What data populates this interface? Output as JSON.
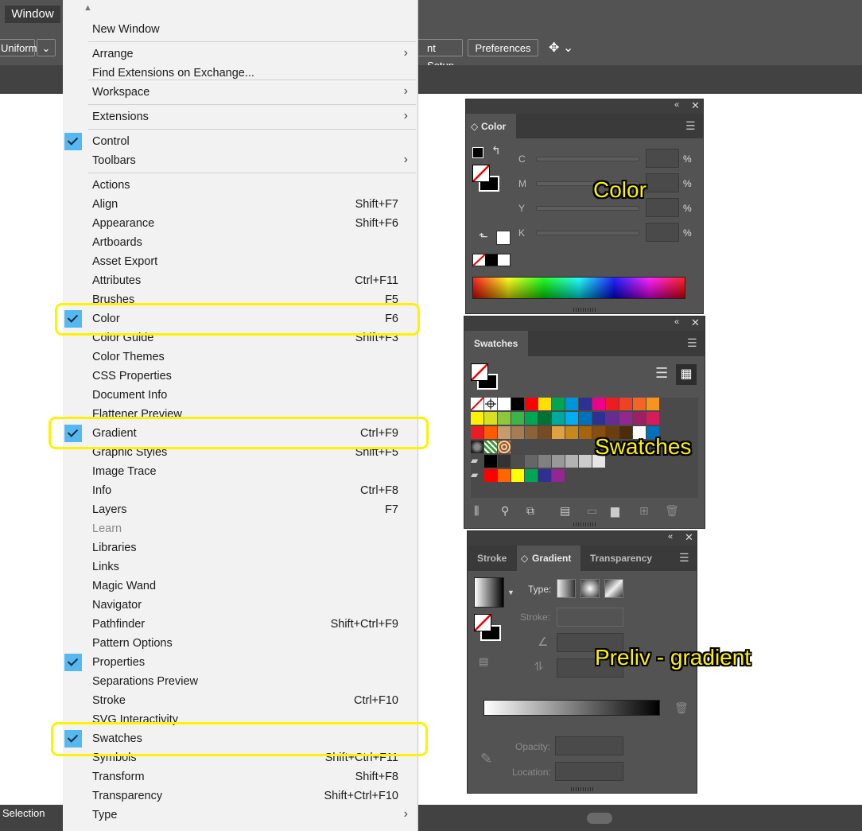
{
  "menubar": {
    "window_label": "Window"
  },
  "controlbar": {
    "uniform_label": "Uniform",
    "document_setup_fragment": "nt Setup",
    "preferences_label": "Preferences"
  },
  "statusbar": {
    "selection_label": "Selection"
  },
  "menu": {
    "items": [
      {
        "label": "New Window",
        "shortcut": "",
        "submenu": false,
        "checked": false
      },
      {
        "label": "Arrange",
        "shortcut": "",
        "submenu": true,
        "checked": false
      },
      {
        "label": "Find Extensions on Exchange...",
        "shortcut": "",
        "submenu": false,
        "checked": false
      },
      {
        "label": "Workspace",
        "shortcut": "",
        "submenu": true,
        "checked": false
      },
      {
        "label": "Extensions",
        "shortcut": "",
        "submenu": true,
        "checked": false
      },
      {
        "label": "Control",
        "shortcut": "",
        "submenu": false,
        "checked": true
      },
      {
        "label": "Toolbars",
        "shortcut": "",
        "submenu": true,
        "checked": false
      },
      {
        "label": "Actions",
        "shortcut": "",
        "submenu": false,
        "checked": false
      },
      {
        "label": "Align",
        "shortcut": "Shift+F7",
        "submenu": false,
        "checked": false
      },
      {
        "label": "Appearance",
        "shortcut": "Shift+F6",
        "submenu": false,
        "checked": false
      },
      {
        "label": "Artboards",
        "shortcut": "",
        "submenu": false,
        "checked": false
      },
      {
        "label": "Asset Export",
        "shortcut": "",
        "submenu": false,
        "checked": false
      },
      {
        "label": "Attributes",
        "shortcut": "Ctrl+F11",
        "submenu": false,
        "checked": false
      },
      {
        "label": "Brushes",
        "shortcut": "F5",
        "submenu": false,
        "checked": false
      },
      {
        "label": "Color",
        "shortcut": "F6",
        "submenu": false,
        "checked": true
      },
      {
        "label": "Color Guide",
        "shortcut": "Shift+F3",
        "submenu": false,
        "checked": false
      },
      {
        "label": "Color Themes",
        "shortcut": "",
        "submenu": false,
        "checked": false
      },
      {
        "label": "CSS Properties",
        "shortcut": "",
        "submenu": false,
        "checked": false
      },
      {
        "label": "Document Info",
        "shortcut": "",
        "submenu": false,
        "checked": false
      },
      {
        "label": "Flattener Preview",
        "shortcut": "",
        "submenu": false,
        "checked": false
      },
      {
        "label": "Gradient",
        "shortcut": "Ctrl+F9",
        "submenu": false,
        "checked": true
      },
      {
        "label": "Graphic Styles",
        "shortcut": "Shift+F5",
        "submenu": false,
        "checked": false
      },
      {
        "label": "Image Trace",
        "shortcut": "",
        "submenu": false,
        "checked": false
      },
      {
        "label": "Info",
        "shortcut": "Ctrl+F8",
        "submenu": false,
        "checked": false
      },
      {
        "label": "Layers",
        "shortcut": "F7",
        "submenu": false,
        "checked": false
      },
      {
        "label": "Learn",
        "shortcut": "",
        "submenu": false,
        "checked": false,
        "disabled": true
      },
      {
        "label": "Libraries",
        "shortcut": "",
        "submenu": false,
        "checked": false
      },
      {
        "label": "Links",
        "shortcut": "",
        "submenu": false,
        "checked": false
      },
      {
        "label": "Magic Wand",
        "shortcut": "",
        "submenu": false,
        "checked": false
      },
      {
        "label": "Navigator",
        "shortcut": "",
        "submenu": false,
        "checked": false
      },
      {
        "label": "Pathfinder",
        "shortcut": "Shift+Ctrl+F9",
        "submenu": false,
        "checked": false
      },
      {
        "label": "Pattern Options",
        "shortcut": "",
        "submenu": false,
        "checked": false
      },
      {
        "label": "Properties",
        "shortcut": "",
        "submenu": false,
        "checked": true
      },
      {
        "label": "Separations Preview",
        "shortcut": "",
        "submenu": false,
        "checked": false
      },
      {
        "label": "Stroke",
        "shortcut": "Ctrl+F10",
        "submenu": false,
        "checked": false
      },
      {
        "label": "SVG Interactivity",
        "shortcut": "",
        "submenu": false,
        "checked": false
      },
      {
        "label": "Swatches",
        "shortcut": "",
        "submenu": false,
        "checked": true
      },
      {
        "label": "Symbols",
        "shortcut": "Shift+Ctrl+F11",
        "submenu": false,
        "checked": false
      },
      {
        "label": "Transform",
        "shortcut": "Shift+F8",
        "submenu": false,
        "checked": false
      },
      {
        "label": "Transparency",
        "shortcut": "Shift+Ctrl+F10",
        "submenu": false,
        "checked": false
      },
      {
        "label": "Type",
        "shortcut": "",
        "submenu": true,
        "checked": false
      }
    ]
  },
  "color_panel": {
    "tab": "Color",
    "channels": [
      {
        "label": "C",
        "unit": "%"
      },
      {
        "label": "M",
        "unit": "%"
      },
      {
        "label": "Y",
        "unit": "%"
      },
      {
        "label": "K",
        "unit": "%"
      }
    ],
    "annotation": "Color"
  },
  "swatches_panel": {
    "tab": "Swatches",
    "annotation": "Swatches",
    "rows": [
      [
        "none",
        "registration",
        "#ffffff",
        "#000000",
        "#ff0000",
        "#ffde00",
        "#00a651",
        "#0095da",
        "#2e3192",
        "#ec008c",
        "#ed1c24",
        "#ef4123",
        "#f26522",
        "#f7941d"
      ],
      [
        "#fff200",
        "#d7e021",
        "#8dc63f",
        "#39b54a",
        "#00a651",
        "#007236",
        "#00a99d",
        "#00aeef",
        "#0072bc",
        "#2e3192",
        "#662d91",
        "#92278f",
        "#9e1f63",
        "#d91a5d"
      ],
      [
        "#ed1c24",
        "#ff5a00",
        "#c69c6d",
        "#a67c52",
        "#8c6239",
        "#754c24",
        "#e1a041",
        "#c8891b",
        "#a8640b",
        "#8a4d10",
        "#6b3d0f",
        "#4d2c0a",
        "#ffffff",
        "#0072bc"
      ],
      [
        "pattern1",
        "pattern2",
        "pattern3"
      ],
      [
        "folder",
        "#000000",
        "#333333",
        "#4d4d4d",
        "#666666",
        "#808080",
        "#999999",
        "#b3b3b3",
        "#cccccc",
        "#e6e6e6"
      ],
      [
        "folder",
        "#ff0000",
        "#ff6600",
        "#ffff00",
        "#00a651",
        "#2e3192",
        "#92278f"
      ]
    ]
  },
  "gradient_panel": {
    "tabs": [
      "Stroke",
      "Gradient",
      "Transparency"
    ],
    "type_label": "Type:",
    "stroke_label": "Stroke:",
    "opacity_label": "Opacity:",
    "location_label": "Location:",
    "annotation": "Preliv - gradient"
  }
}
